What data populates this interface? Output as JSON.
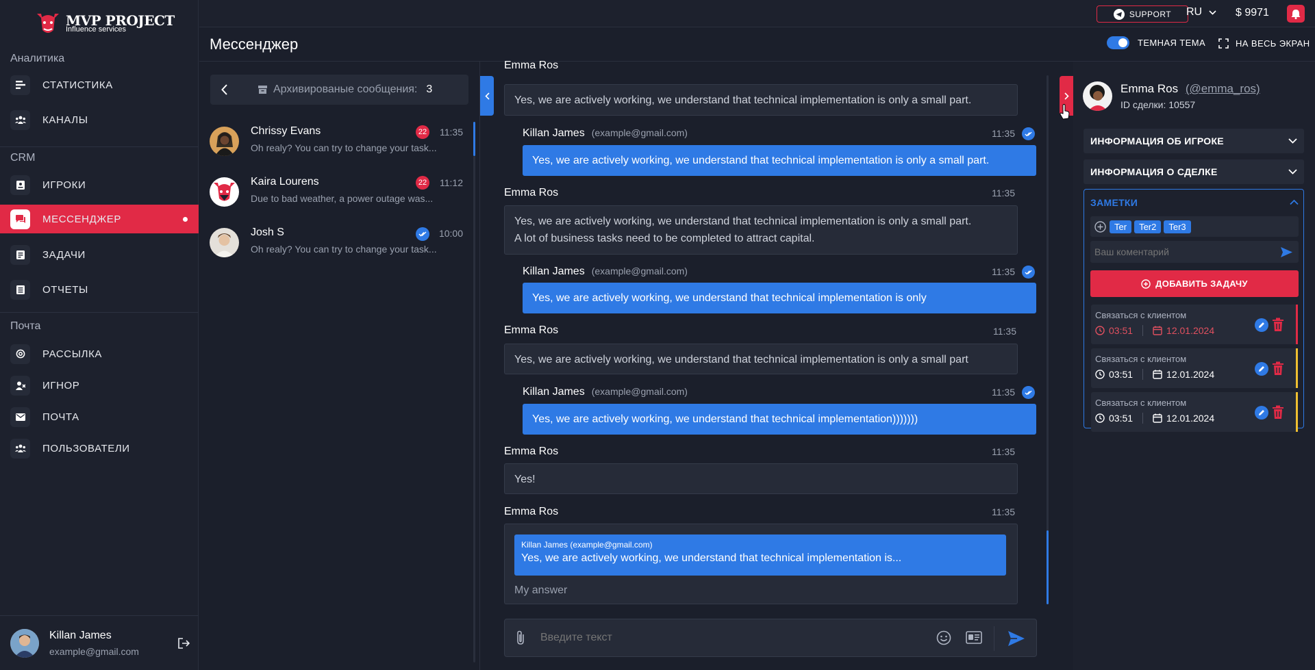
{
  "brand": {
    "title": "MVP PROJECT",
    "subtitle": "Influence services"
  },
  "topbar": {
    "support": "SUPPORT",
    "lang": "RU",
    "balance": "$ 9971"
  },
  "header": {
    "title": "Мессенджер",
    "theme_label": "ТЕМНАЯ ТЕМА",
    "fullscreen_label": "НА ВЕСЬ ЭКРАН",
    "theme_on": true
  },
  "sidebar": {
    "sections": [
      "Аналитика",
      "CRM",
      "Почта"
    ],
    "items": [
      {
        "label": "СТАТИСТИКА",
        "icon": "bar-chart-icon"
      },
      {
        "label": "КАНАЛЫ",
        "icon": "users-group-icon"
      },
      {
        "label": "ИГРОКИ",
        "icon": "id-card-icon"
      },
      {
        "label": "МЕССЕНДЖЕР",
        "icon": "chat-icon",
        "active": true
      },
      {
        "label": "ЗАДАЧИ",
        "icon": "tasks-icon"
      },
      {
        "label": "ОТЧЕТЫ",
        "icon": "report-icon"
      },
      {
        "label": "РАССЫЛКА",
        "icon": "at-icon"
      },
      {
        "label": "ИГНОР",
        "icon": "user-block-icon"
      },
      {
        "label": "ПОЧТА",
        "icon": "mail-icon"
      },
      {
        "label": "ПОЛЬЗОВАТЕЛИ",
        "icon": "users-icon"
      }
    ],
    "user": {
      "name": "Killan James",
      "email": "example@gmail.com"
    }
  },
  "archive": {
    "label": "Архивированые сообщения:",
    "count": "3"
  },
  "conversations": [
    {
      "name": "Chrissy Evans",
      "preview": "Oh realy? You can try to change your task...",
      "time": "11:35",
      "badge": "22"
    },
    {
      "name": "Kaira Lourens",
      "preview": "Due to bad weather, a power outage was...",
      "time": "11:12",
      "badge": "22"
    },
    {
      "name": "Josh S",
      "preview": "Oh realy? You can try to change your task...",
      "time": "10:00",
      "badge": ""
    }
  ],
  "messages": [
    {
      "name": "Emma Ros",
      "time": "",
      "text": "Yes, we are actively working, we understand that technical implementation is only a small part."
    },
    {
      "name": "Killan James",
      "email": "(example@gmail.com)",
      "time": "11:35",
      "text": "Yes, we are actively working, we understand that technical implementation is only a small part."
    },
    {
      "name": "Emma Ros",
      "time": "11:35",
      "text": "Yes, we are actively working, we understand that technical implementation is only a small part.",
      "text2": "A lot of business tasks need to be completed to attract capital."
    },
    {
      "name": "Killan James",
      "email": "(example@gmail.com)",
      "time": "11:35",
      "text": "Yes, we are actively working, we understand that technical implementation is only"
    },
    {
      "name": "Emma Ros",
      "time": "11:35",
      "text": "Yes, we are actively working, we understand that technical implementation is only a small part"
    },
    {
      "name": "Killan James",
      "email": "(example@gmail.com)",
      "time": "11:35",
      "text": "Yes, we are actively working, we understand that technical implementation)))))))"
    },
    {
      "name": "Emma Ros",
      "time": "11:35",
      "text": "Yes!"
    },
    {
      "name": "Emma Ros",
      "time": "11:35",
      "quote_author": "Killan James (example@gmail.com)",
      "quote_text": "Yes, we are actively working, we understand that technical implementation is...",
      "text": "My answer"
    }
  ],
  "composer": {
    "placeholder": "Введите текст"
  },
  "contact": {
    "name": "Emma Ros",
    "handle": "(@emma_ros)",
    "deal_id": "ID сделки: 10557"
  },
  "panels": {
    "player_info": "ИНФОРМАЦИЯ ОБ ИГРОКЕ",
    "deal_info": "ИНФОРМАЦИЯ О СДЕЛКЕ",
    "notes": "ЗАМЕТКИ"
  },
  "notes": {
    "tags": [
      "Ter",
      "Ter2",
      "Ter3"
    ],
    "comment_placeholder": "Ваш коментарий",
    "add_task": "ДОБАВИТЬ ЗАДАЧУ",
    "tasks": [
      {
        "title": "Связаться с клиентом",
        "time": "03:51",
        "date": "12.01.2024",
        "overdue": true
      },
      {
        "title": "Связаться с клиентом",
        "time": "03:51",
        "date": "12.01.2024",
        "overdue": false
      },
      {
        "title": "Связаться с клиентом",
        "time": "03:51",
        "date": "12.01.2024",
        "overdue": false
      }
    ]
  },
  "colors": {
    "accent": "#2f7ae5",
    "danger": "#e12a46",
    "warning": "#f0c030",
    "bg": "#1b1f2b"
  }
}
